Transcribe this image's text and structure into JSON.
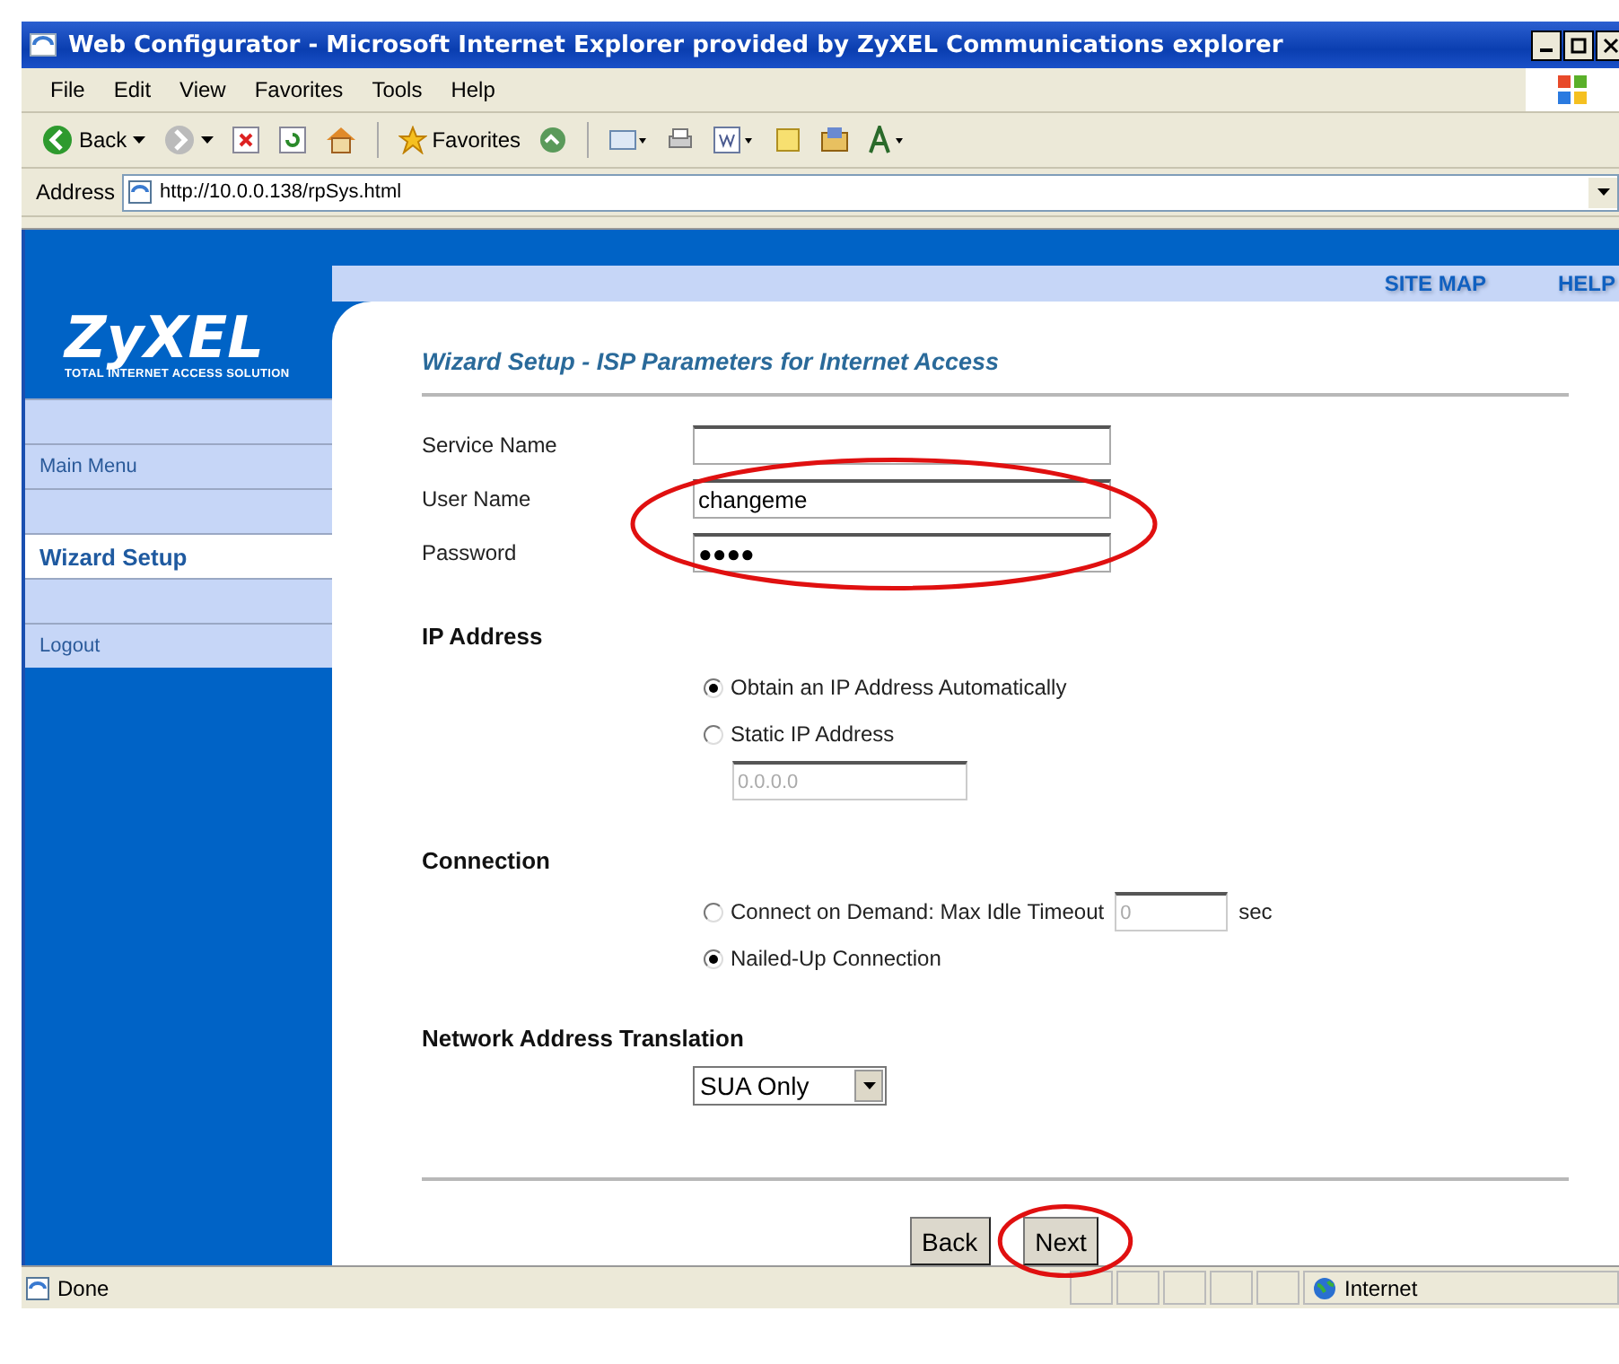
{
  "window": {
    "title": "Web Configurator - Microsoft Internet Explorer provided by ZyXEL Communications explorer"
  },
  "menu": [
    "File",
    "Edit",
    "View",
    "Favorites",
    "Tools",
    "Help"
  ],
  "toolbar": [
    {
      "kind": "back",
      "label": "Back"
    },
    {
      "kind": "forward"
    },
    {
      "kind": "stop"
    },
    {
      "kind": "refresh"
    },
    {
      "kind": "home"
    },
    {
      "kind": "favorites",
      "label": "Favorites"
    },
    {
      "kind": "media"
    },
    {
      "kind": "mail"
    },
    {
      "kind": "print"
    },
    {
      "kind": "edit"
    },
    {
      "kind": "note"
    },
    {
      "kind": "folder"
    },
    {
      "kind": "font"
    }
  ],
  "address_bar": {
    "label": "Address",
    "url": "http://10.0.0.138/rpSys.html"
  },
  "header": {
    "logo": "ZyXEL",
    "tagline": "TOTAL INTERNET ACCESS SOLUTION",
    "links": [
      "SITE MAP",
      "HELP"
    ]
  },
  "sidebar": {
    "items": [
      {
        "label": "Main Menu",
        "selected": false
      },
      {
        "label": "Wizard Setup",
        "selected": true
      },
      {
        "label": "Logout",
        "selected": false
      }
    ]
  },
  "form": {
    "title": "Wizard Setup - ISP Parameters for Internet Access",
    "fields": [
      {
        "label": "Service Name",
        "circled": false
      },
      {
        "label": "User Name",
        "value": "changeme",
        "circled": true
      },
      {
        "label": "Password",
        "value": "●●●●",
        "circled": true
      }
    ],
    "sections": [
      {
        "heading": "IP Address",
        "options": [
          {
            "label": "Obtain an IP Address Automatically",
            "selected": true
          },
          {
            "label": "Static IP Address",
            "selected": false,
            "input": {
              "value": "0.0.0.0",
              "disabled": true
            }
          }
        ]
      },
      {
        "heading": "Connection",
        "options": [
          {
            "label": "Connect on Demand: Max Idle Timeout",
            "selected": false,
            "input": {
              "value": "0",
              "disabled": true,
              "unit": "sec"
            }
          },
          {
            "label": "Nailed-Up Connection",
            "selected": true
          }
        ]
      }
    ],
    "nat": {
      "heading": "Network Address Translation",
      "value": "SUA Only"
    },
    "buttons": [
      {
        "label": "Back",
        "circled": false
      },
      {
        "label": "Next",
        "circled": true
      }
    ]
  },
  "status_bar": {
    "text": "Done",
    "zone": "Internet"
  }
}
